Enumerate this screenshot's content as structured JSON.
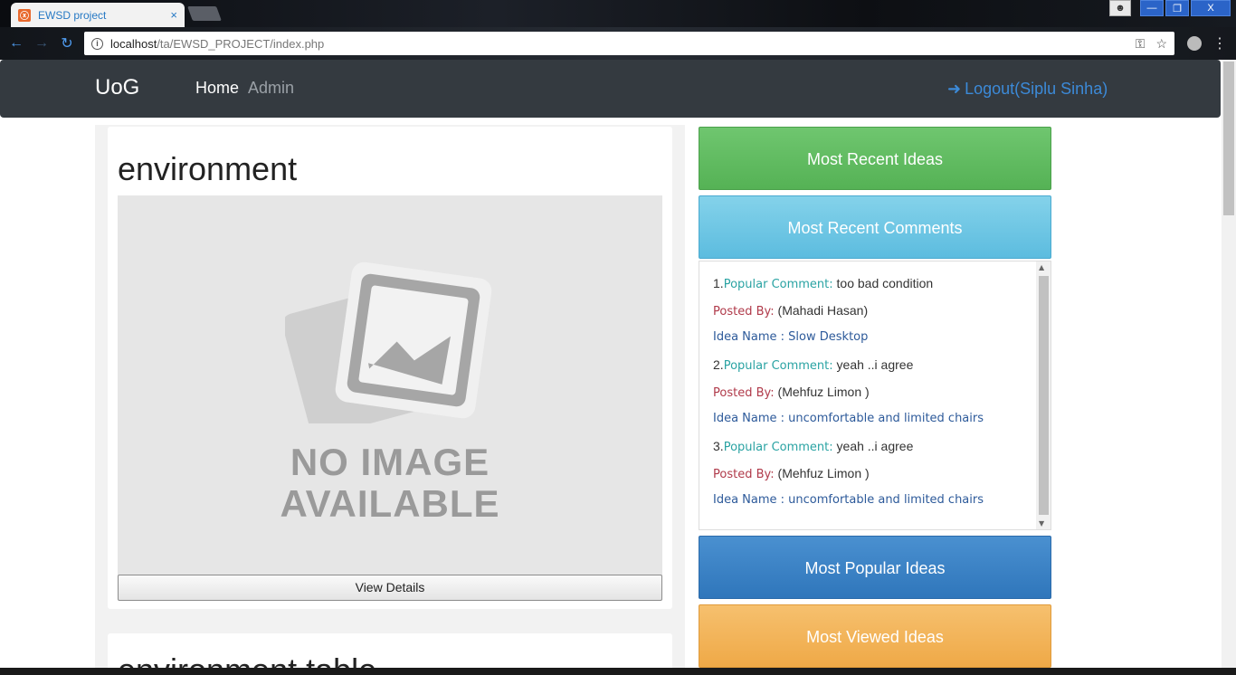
{
  "browser": {
    "tab_title": "EWSD project",
    "tab_close": "×",
    "favicon": "ⓧ",
    "url_host": "localhost",
    "url_path": "/ta/EWSD_PROJECT/index.php",
    "window_buttons": {
      "minimize": "—",
      "restore": "❐",
      "close": "X"
    }
  },
  "navbar": {
    "brand": "UoG",
    "links": [
      "Home",
      "Admin"
    ],
    "logout_label": "Logout(Siplu Sinha)"
  },
  "main": {
    "cards": [
      {
        "title": "environment",
        "image_text_line1": "NO IMAGE",
        "image_text_line2": "AVAILABLE",
        "button": "View Details"
      },
      {
        "title": "environment table"
      }
    ]
  },
  "sidebar": {
    "most_recent_ideas": "Most Recent Ideas",
    "most_recent_comments": "Most Recent Comments",
    "most_popular_ideas": "Most Popular Ideas",
    "most_viewed_ideas": "Most Viewed Ideas",
    "comments": [
      {
        "num": "1.",
        "label": "Popular Comment:",
        "text": " too bad condition",
        "by_label": "Posted By:",
        "by": " (Mahadi Hasan)",
        "idea": "Idea Name : Slow Desktop"
      },
      {
        "num": "2.",
        "label": "Popular Comment:",
        "text": " yeah ..i agree",
        "by_label": "Posted By:",
        "by": " (Mehfuz Limon )",
        "idea": "Idea Name : uncomfortable and limited chairs"
      },
      {
        "num": "3.",
        "label": "Popular Comment:",
        "text": " yeah ..i agree",
        "by_label": "Posted By:",
        "by": " (Mehfuz Limon )",
        "idea": "Idea Name : uncomfortable and limited chairs"
      }
    ]
  },
  "colors": {
    "navbar": "#343a40",
    "green": "#5cb85c",
    "info": "#5bc0de",
    "primary": "#337ab7",
    "warning": "#f0ad4e"
  }
}
